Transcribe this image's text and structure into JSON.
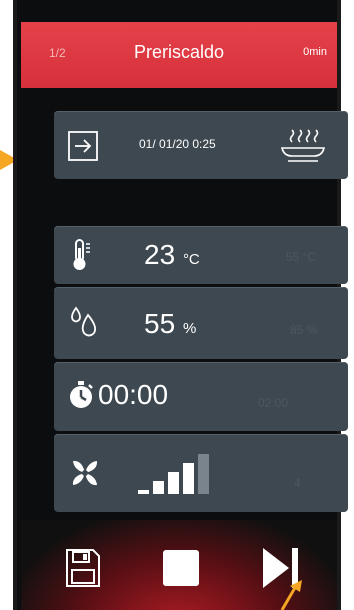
{
  "header": {
    "step": "1/2",
    "title": "Preriscaldo",
    "duration": "0min"
  },
  "schedule": {
    "datetime": "01/ 01/20  0:25"
  },
  "temperature": {
    "value": "23",
    "unit": "°C",
    "target": "55 °C"
  },
  "humidity": {
    "value": "55",
    "unit": "%",
    "target": "85 %"
  },
  "timer": {
    "value": "00:00",
    "target": "02:00"
  },
  "fan": {
    "level": 4,
    "levels": 5,
    "target": "4"
  },
  "colors": {
    "header": "#e5414a",
    "card": "#3e4850",
    "arrow": "#f5a623"
  },
  "icons": {
    "start": "enter-icon",
    "steam": "steam-tray-icon",
    "thermo": "thermometer-icon",
    "drop": "humidity-icon",
    "timer": "stopwatch-icon",
    "fan": "fan-icon",
    "save": "save-icon",
    "stop": "stop-icon",
    "next": "skip-next-icon"
  }
}
